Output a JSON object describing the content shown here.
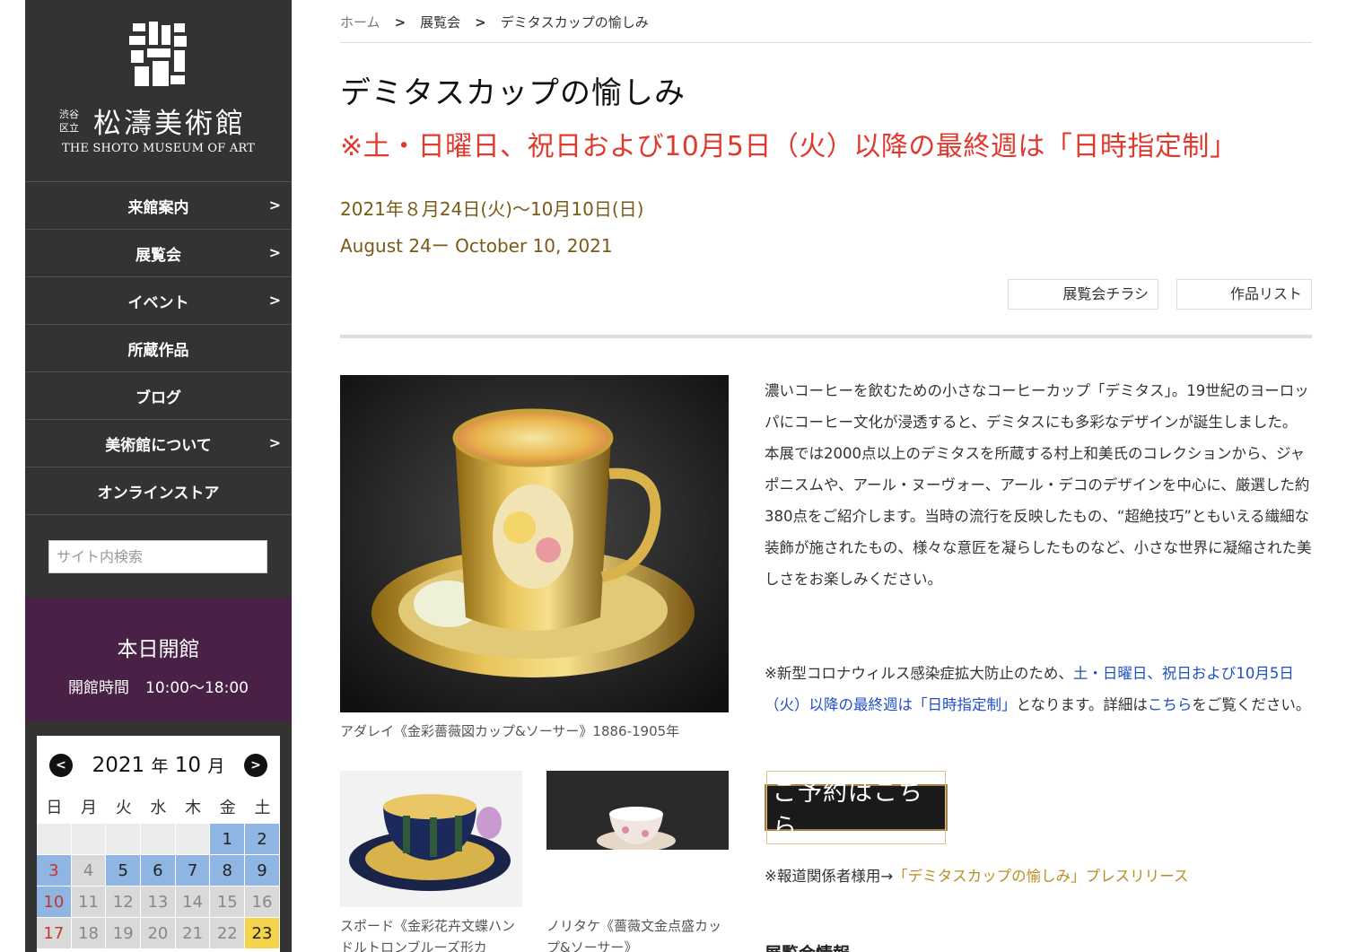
{
  "sidebar": {
    "logo": {
      "sub_top": "渋谷",
      "sub_bottom": "区立",
      "name": "松濤美術館",
      "english": "THE SHOTO MUSEUM OF ART"
    },
    "nav": [
      {
        "label": "来館案内",
        "has_submenu": true
      },
      {
        "label": "展覧会",
        "has_submenu": true
      },
      {
        "label": "イベント",
        "has_submenu": true
      },
      {
        "label": "所蔵作品",
        "has_submenu": false
      },
      {
        "label": "ブログ",
        "has_submenu": false
      },
      {
        "label": "美術館について",
        "has_submenu": true
      },
      {
        "label": "オンラインストア",
        "has_submenu": false
      }
    ],
    "search_placeholder": "サイト内検索",
    "open_status": {
      "title": "本日開館",
      "hours_label": "開館時間",
      "hours": "10:00〜18:00"
    },
    "calendar": {
      "year": "2021",
      "year_unit": "年",
      "month": "10",
      "month_unit": "月",
      "weekdays": [
        "日",
        "月",
        "火",
        "水",
        "木",
        "金",
        "土"
      ],
      "leading_blanks": 5,
      "days": [
        {
          "d": "1",
          "s": "open"
        },
        {
          "d": "2",
          "s": "open"
        },
        {
          "d": "3",
          "s": "open"
        },
        {
          "d": "4",
          "s": "closed"
        },
        {
          "d": "5",
          "s": "open"
        },
        {
          "d": "6",
          "s": "open"
        },
        {
          "d": "7",
          "s": "open"
        },
        {
          "d": "8",
          "s": "open"
        },
        {
          "d": "9",
          "s": "open"
        },
        {
          "d": "10",
          "s": "open"
        },
        {
          "d": "11",
          "s": "closed"
        },
        {
          "d": "12",
          "s": "closed"
        },
        {
          "d": "13",
          "s": "closed"
        },
        {
          "d": "14",
          "s": "closed"
        },
        {
          "d": "15",
          "s": "closed"
        },
        {
          "d": "16",
          "s": "closed"
        },
        {
          "d": "17",
          "s": "closed"
        },
        {
          "d": "18",
          "s": "closed"
        },
        {
          "d": "19",
          "s": "closed"
        },
        {
          "d": "20",
          "s": "closed"
        },
        {
          "d": "21",
          "s": "closed"
        },
        {
          "d": "22",
          "s": "closed"
        },
        {
          "d": "23",
          "s": "today"
        }
      ]
    }
  },
  "breadcrumb": [
    "ホーム",
    "展覧会",
    "デミタスカップの愉しみ"
  ],
  "exhibition": {
    "title": "デミタスカップの愉しみ",
    "notice": "※土・日曜日、祝日および10月5日（火）以降の最終週は「日時指定制」",
    "date_jp": "2021年８月24日(火)〜10月10日(日)",
    "date_en": "August 24ー October 10, 2021",
    "buttons": {
      "flyer": "展覧会チラシ",
      "list": "作品リスト"
    },
    "main_caption": "アダレイ《金彩薔薇図カップ&ソーサー》1886-1905年",
    "thumb1_caption": "スポード《金彩花卉文蝶ハンドルトロンブルーズ形カ",
    "thumb2_caption": "ノリタケ《薔薇文金点盛カップ&ソーサー》",
    "description": [
      "濃いコーヒーを飲むための小さなコーヒーカップ「デミタス」。19世紀のヨーロッパにコーヒー文化が浸透すると、デミタスにも多彩なデザインが誕生しました。",
      "本展では2000点以上のデミタスを所蔵する村上和美氏のコレクションから、ジャポニスムや、アール・ヌーヴォー、アール・デコのデザインを中心に、厳選した約380点をご紹介します。当時の流行を反映したもの、“超絶技巧”ともいえる繊細な装飾が施されたもの、様々な意匠を凝らしたものなど、小さな世界に凝縮された美しさをお楽しみください。"
    ],
    "covid": {
      "prefix": "※新型コロナウィルス感染症拡大防止のため、",
      "highlight": "土・日曜日、祝日および10月5日（火）以降の最終週は「日時指定制」",
      "middle": "となります。詳細は",
      "link": "こちら",
      "suffix": "をご覧ください。"
    },
    "reserve_label": "ご予約はこちら",
    "press": {
      "prefix": "※報道関係者様用→",
      "link": "「デミタスカップの愉しみ」プレスリリース"
    },
    "info_heading": "展覧会情報"
  }
}
